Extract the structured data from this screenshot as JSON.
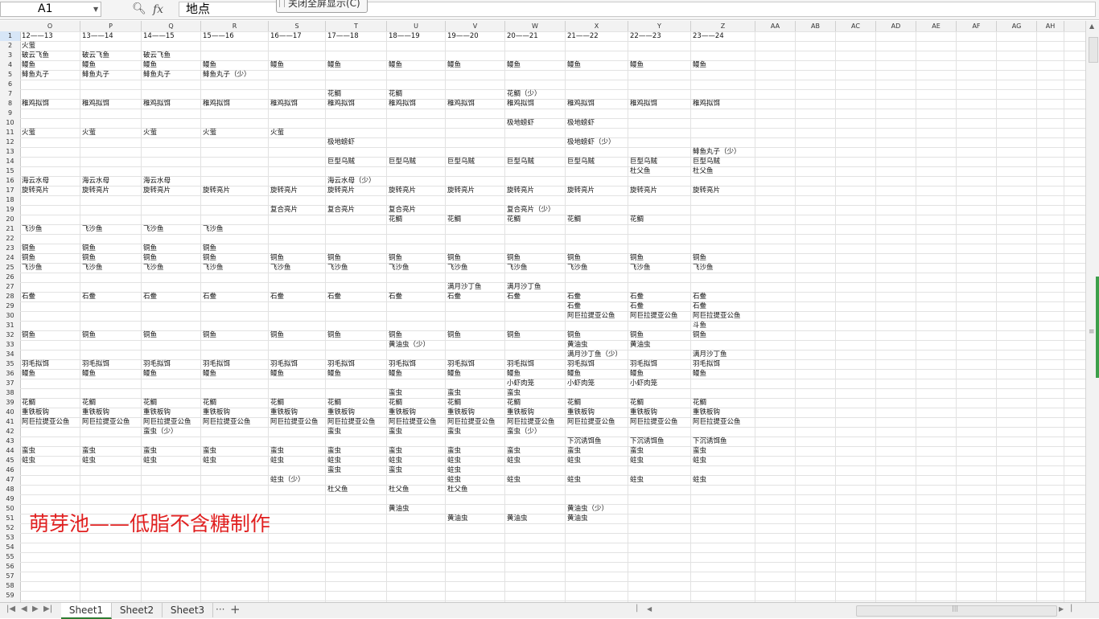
{
  "formula_bar": {
    "name_box": "A1",
    "formula": "地点",
    "fullscreen_tip": "关闭全屏显示(C)"
  },
  "columns": [
    "O",
    "P",
    "Q",
    "R",
    "S",
    "T",
    "U",
    "V",
    "W",
    "X",
    "Y",
    "Z",
    "AA",
    "AB",
    "AC",
    "AD",
    "AE",
    "AF",
    "AG",
    "AH"
  ],
  "rows": [
    1,
    2,
    3,
    4,
    5,
    6,
    7,
    8,
    9,
    10,
    11,
    12,
    13,
    14,
    15,
    16,
    17,
    18,
    19,
    20,
    21,
    22,
    23,
    24,
    25,
    26,
    27,
    28,
    29,
    30,
    31,
    32,
    33,
    34,
    35,
    36,
    37,
    38,
    39,
    40,
    41,
    42,
    43,
    44,
    45,
    46,
    47,
    48,
    49,
    50,
    51,
    52,
    53,
    54,
    55,
    56,
    57,
    58,
    59
  ],
  "cells": {
    "1": [
      "12——13",
      "13——14",
      "14——15",
      "15——16",
      "16——17",
      "17——18",
      "18——19",
      "19——20",
      "20——21",
      "21——22",
      "22——23",
      "23——24"
    ],
    "2": [
      "火萤"
    ],
    "3": [
      "破云飞鱼",
      "破云飞鱼",
      "破云飞鱼"
    ],
    "4": [
      "鳗鱼",
      "鳗鱼",
      "鳗鱼",
      "鳗鱼",
      "鳗鱼",
      "鳗鱼",
      "鳗鱼",
      "鳗鱼",
      "鳗鱼",
      "鳗鱼",
      "鳗鱼",
      "鳗鱼"
    ],
    "5": [
      "鲱鱼丸子",
      "鲱鱼丸子",
      "鲱鱼丸子",
      "鲱鱼丸子（少）"
    ],
    "7": [
      "",
      "",
      "",
      "",
      "",
      "花鲷",
      "花鲷",
      "",
      "花鲷（少）"
    ],
    "8": [
      "稚鸡拟饵",
      "稚鸡拟饵",
      "稚鸡拟饵",
      "稚鸡拟饵",
      "稚鸡拟饵",
      "稚鸡拟饵",
      "稚鸡拟饵",
      "稚鸡拟饵",
      "稚鸡拟饵",
      "稚鸡拟饵",
      "稚鸡拟饵",
      "稚鸡拟饵"
    ],
    "10": [
      "",
      "",
      "",
      "",
      "",
      "",
      "",
      "",
      "极地螃虾",
      "极地螃虾"
    ],
    "11": [
      "火萤",
      "火萤",
      "火萤",
      "火萤",
      "火萤"
    ],
    "12": [
      "",
      "",
      "",
      "",
      "",
      "极地螃虾",
      "",
      "",
      "",
      "极地螃虾（少）"
    ],
    "13": [
      "",
      "",
      "",
      "",
      "",
      "",
      "",
      "",
      "",
      "",
      "",
      "鲱鱼丸子（少）"
    ],
    "14": [
      "",
      "",
      "",
      "",
      "",
      "巨型乌贼",
      "巨型乌贼",
      "巨型乌贼",
      "巨型乌贼",
      "巨型乌贼",
      "巨型乌贼",
      "巨型乌贼"
    ],
    "15": [
      "",
      "",
      "",
      "",
      "",
      "",
      "",
      "",
      "",
      "",
      "杜父鱼",
      "杜父鱼"
    ],
    "16": [
      "海云水母",
      "海云水母",
      "海云水母",
      "",
      "",
      "海云水母（少）"
    ],
    "17": [
      "旋转亮片",
      "旋转亮片",
      "旋转亮片",
      "旋转亮片",
      "旋转亮片",
      "旋转亮片",
      "旋转亮片",
      "旋转亮片",
      "旋转亮片",
      "旋转亮片",
      "旋转亮片",
      "旋转亮片"
    ],
    "19": [
      "",
      "",
      "",
      "",
      "复合亮片",
      "复合亮片",
      "复合亮片",
      "",
      "复合亮片（少）"
    ],
    "20": [
      "",
      "",
      "",
      "",
      "",
      "",
      "花鲷",
      "花鲷",
      "花鲷",
      "花鲷",
      "花鲷"
    ],
    "21": [
      "飞沙鱼",
      "飞沙鱼",
      "飞沙鱼",
      "飞沙鱼"
    ],
    "23": [
      "铜鱼",
      "铜鱼",
      "铜鱼",
      "铜鱼"
    ],
    "24": [
      "铜鱼",
      "铜鱼",
      "铜鱼",
      "铜鱼",
      "铜鱼",
      "铜鱼",
      "铜鱼",
      "铜鱼",
      "铜鱼",
      "铜鱼",
      "铜鱼",
      "铜鱼"
    ],
    "25": [
      "飞沙鱼",
      "飞沙鱼",
      "飞沙鱼",
      "飞沙鱼",
      "飞沙鱼",
      "飞沙鱼",
      "飞沙鱼",
      "飞沙鱼",
      "飞沙鱼",
      "飞沙鱼",
      "飞沙鱼",
      "飞沙鱼"
    ],
    "27": [
      "",
      "",
      "",
      "",
      "",
      "",
      "",
      "满月沙丁鱼",
      "满月沙丁鱼"
    ],
    "28": [
      "石鲞",
      "石鲞",
      "石鲞",
      "石鲞",
      "石鲞",
      "石鲞",
      "石鲞",
      "石鲞",
      "石鲞",
      "石鲞",
      "石鲞",
      "石鲞"
    ],
    "29": [
      "",
      "",
      "",
      "",
      "",
      "",
      "",
      "",
      "",
      "石鲞",
      "石鲞",
      "石鲞"
    ],
    "30": [
      "",
      "",
      "",
      "",
      "",
      "",
      "",
      "",
      "",
      "阿巨拉提亚公鱼",
      "阿巨拉提亚公鱼",
      "阿巨拉提亚公鱼"
    ],
    "31": [
      "",
      "",
      "",
      "",
      "",
      "",
      "",
      "",
      "",
      "",
      "",
      "斗鱼"
    ],
    "32": [
      "铜鱼",
      "铜鱼",
      "铜鱼",
      "铜鱼",
      "铜鱼",
      "铜鱼",
      "铜鱼",
      "铜鱼",
      "铜鱼",
      "铜鱼",
      "铜鱼",
      "铜鱼"
    ],
    "33": [
      "",
      "",
      "",
      "",
      "",
      "",
      "黄油虫（少）",
      "",
      "",
      "黄油虫",
      "黄油虫"
    ],
    "34": [
      "",
      "",
      "",
      "",
      "",
      "",
      "",
      "",
      "",
      "满月沙丁鱼（少）",
      "",
      "满月沙丁鱼"
    ],
    "35": [
      "羽毛拟饵",
      "羽毛拟饵",
      "羽毛拟饵",
      "羽毛拟饵",
      "羽毛拟饵",
      "羽毛拟饵",
      "羽毛拟饵",
      "羽毛拟饵",
      "羽毛拟饵",
      "羽毛拟饵",
      "羽毛拟饵",
      "羽毛拟饵"
    ],
    "36": [
      "鳗鱼",
      "鳗鱼",
      "鳗鱼",
      "鳗鱼",
      "鳗鱼",
      "鳗鱼",
      "鳗鱼",
      "鳗鱼",
      "鳗鱼",
      "鳗鱼",
      "鳗鱼",
      "鳗鱼"
    ],
    "37": [
      "",
      "",
      "",
      "",
      "",
      "",
      "",
      "",
      "小虾肉笼",
      "小虾肉笼",
      "小虾肉笼"
    ],
    "38": [
      "",
      "",
      "",
      "",
      "",
      "",
      "蛮虫",
      "蛮虫",
      "蛮虫"
    ],
    "39": [
      "花鲷",
      "花鲷",
      "花鲷",
      "花鲷",
      "花鲷",
      "花鲷",
      "花鲷",
      "花鲷",
      "花鲷",
      "花鲷",
      "花鲷",
      "花鲷"
    ],
    "40": [
      "重铁板钩",
      "重铁板钩",
      "重铁板钩",
      "重铁板钩",
      "重铁板钩",
      "重铁板钩",
      "重铁板钩",
      "重铁板钩",
      "重铁板钩",
      "重铁板钩",
      "重铁板钩",
      "重铁板钩"
    ],
    "41": [
      "阿巨拉提亚公鱼",
      "阿巨拉提亚公鱼",
      "阿巨拉提亚公鱼",
      "阿巨拉提亚公鱼",
      "阿巨拉提亚公鱼",
      "阿巨拉提亚公鱼",
      "阿巨拉提亚公鱼",
      "阿巨拉提亚公鱼",
      "阿巨拉提亚公鱼",
      "阿巨拉提亚公鱼",
      "阿巨拉提亚公鱼",
      "阿巨拉提亚公鱼"
    ],
    "42": [
      "",
      "",
      "蛮虫（少）",
      "",
      "",
      "蛮虫",
      "蛮虫",
      "蛮虫",
      "蛮虫（少）"
    ],
    "43": [
      "",
      "",
      "",
      "",
      "",
      "",
      "",
      "",
      "",
      "下沉诱饵鱼",
      "下沉诱饵鱼",
      "下沉诱饵鱼"
    ],
    "44": [
      "蛮虫",
      "蛮虫",
      "蛮虫",
      "蛮虫",
      "蛮虫",
      "蛮虫",
      "蛮虫",
      "蛮虫",
      "蛮虫",
      "蛮虫",
      "蛮虫",
      "蛮虫"
    ],
    "45": [
      "蛀虫",
      "蛀虫",
      "蛀虫",
      "蛀虫",
      "蛀虫",
      "蛀虫",
      "蛀虫",
      "蛀虫",
      "蛀虫",
      "蛀虫",
      "蛀虫",
      "蛀虫"
    ],
    "46": [
      "",
      "",
      "",
      "",
      "",
      "蛮虫",
      "蛮虫",
      "蛀虫"
    ],
    "47": [
      "",
      "",
      "",
      "",
      "蛀虫（少）",
      "",
      "",
      "蛀虫",
      "蛀虫",
      "蛀虫",
      "蛀虫",
      "蛀虫"
    ],
    "48": [
      "",
      "",
      "",
      "",
      "",
      "杜父鱼",
      "杜父鱼",
      "杜父鱼"
    ],
    "50": [
      "",
      "",
      "",
      "",
      "",
      "",
      "黄油虫",
      "",
      "",
      "黄油虫（少）"
    ],
    "51": [
      "",
      "",
      "",
      "",
      "",
      "",
      "",
      "黄油虫",
      "黄油虫",
      "黄油虫"
    ]
  },
  "note": "萌芽池——低脂不含糖制作",
  "sheets": [
    "Sheet1",
    "Sheet2",
    "Sheet3"
  ],
  "sheet_more": "···",
  "add_sheet": "+",
  "accent_green": "#2e7d32",
  "note_color": "#e02020"
}
